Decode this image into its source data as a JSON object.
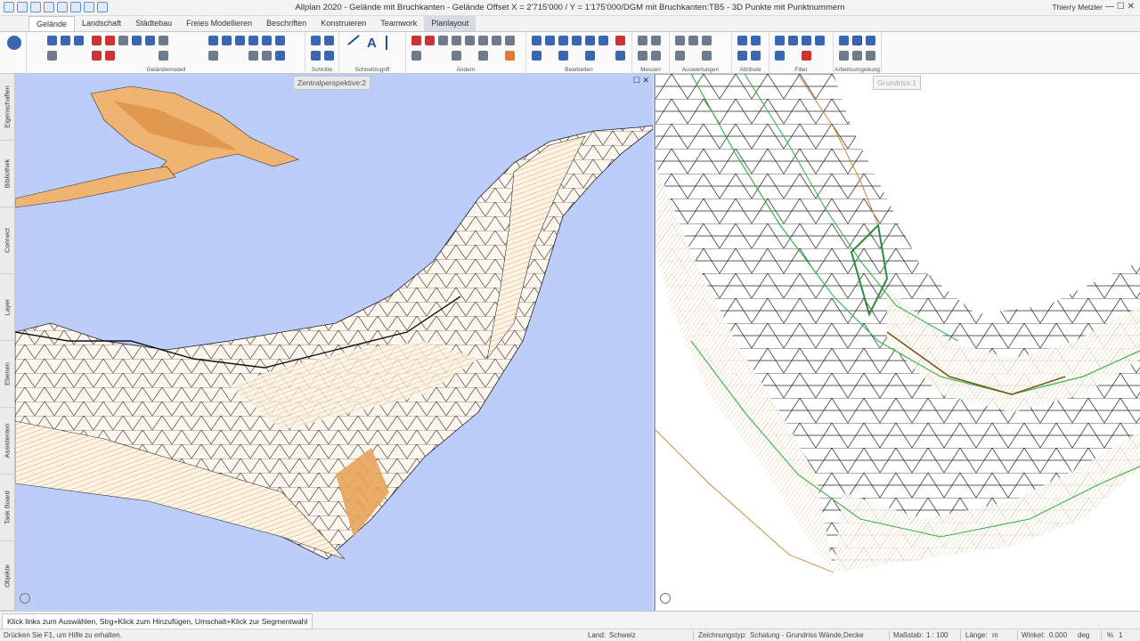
{
  "app": {
    "title": "Allplan 2020 - Gelände mit Bruchkanten - Gelände Offset X = 2'715'000 / Y = 1'175'000/DGM mit Bruchkanten:TB5 - 3D Punkte mit Punktnummern",
    "user": "Thierry Metzler"
  },
  "tabs": [
    "Gelände",
    "Landschaft",
    "Städtebau",
    "Freies Modellieren",
    "Beschriften",
    "Konstruieren",
    "Teamwork",
    "Planlayout"
  ],
  "ribbon_groups": [
    "Geländemodell",
    "Schnitte",
    "Schnellzugriff",
    "Ändern",
    "Bearbeiten",
    "Messen",
    "Auswertungen",
    "Attribute",
    "Filter",
    "Arbeitsumgebung"
  ],
  "sidebar_tabs": [
    "Eigenschaften",
    "Bibliothek",
    "Connect",
    "Layer",
    "Ebenen",
    "Assistenten",
    "Task Board",
    "Objekte"
  ],
  "views": {
    "left_label": "Zentralperspektive:2",
    "right_label": "Grundriss:1"
  },
  "command_prompt": "Klick links zum Auswählen, Strg+Klick zum Hinzufügen, Umschalt+Klick zur Segmentwahl",
  "status": {
    "help": "Drücken Sie F1, um Hilfe zu erhalten.",
    "land_label": "Land:",
    "land_value": "Schweiz",
    "zeichnungstyp_label": "Zeichnungstyp:",
    "zeichnungstyp_value": "Schalung - Grundriss Wände,Decke",
    "massstab_label": "Maßstab:",
    "massstab_value": "1 : 100",
    "laenge_label": "Länge:",
    "laenge_value": "m",
    "winkel_label": "Winkel:",
    "winkel_value": "0.000",
    "winkel_unit": "deg",
    "percent_value": "%",
    "percent_extra": "1"
  },
  "colors": {
    "sky": "#bccdfa",
    "terrain_fill": "#fdf4e6",
    "terrain_orange": "#e8a35a",
    "mesh_line": "#1a1a1a",
    "hatch": "#c8892e",
    "green": "#39b54a"
  }
}
